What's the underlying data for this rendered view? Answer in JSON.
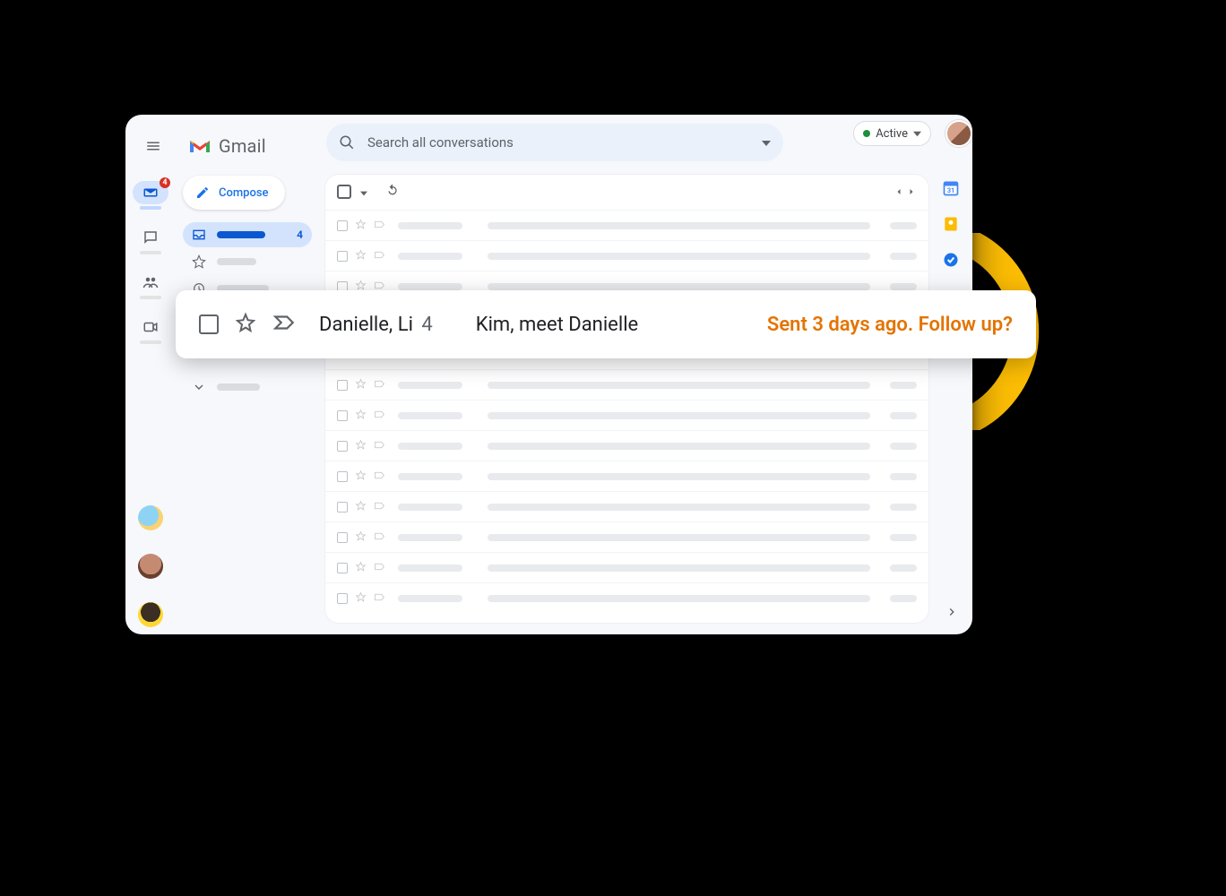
{
  "header": {
    "brand": "Gmail",
    "search_placeholder": "Search all conversations",
    "status_label": "Active",
    "mail_badge": "4"
  },
  "sidebar": {
    "compose_label": "Compose",
    "inbox_count": "4"
  },
  "highlight": {
    "from": "Danielle, Li",
    "thread_count": "4",
    "subject": "Kim, meet Danielle",
    "nudge": "Sent 3 days ago. Follow up?"
  }
}
